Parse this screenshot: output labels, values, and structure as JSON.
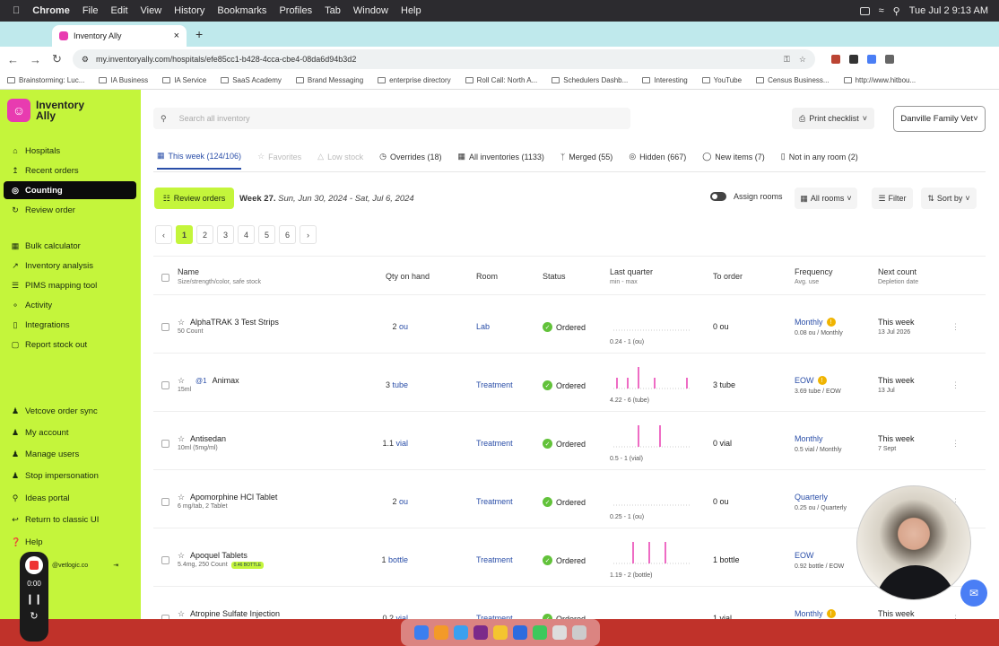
{
  "menubar": {
    "app": "Chrome",
    "items": [
      "File",
      "Edit",
      "View",
      "History",
      "Bookmarks",
      "Profiles",
      "Tab",
      "Window",
      "Help"
    ],
    "clock": "Tue Jul 2  9:13 AM"
  },
  "browser": {
    "tab_title": "Inventory Ally",
    "url": "my.inventoryally.com/hospitals/efe85cc1-b428-4cca-cbe4-08da6d94b3d2",
    "bookmarks": [
      "Brainstorming: Luc...",
      "IA Business",
      "IA Service",
      "SaaS Academy",
      "Brand Messaging",
      "enterprise directory",
      "Roll Call: North A...",
      "Schedulers Dashb...",
      "Interesting",
      "YouTube",
      "Census Business...",
      "http://www.hitbou..."
    ]
  },
  "sidebar": {
    "brand": "Inventory Ally",
    "items": [
      "Hospitals",
      "Recent orders",
      "Counting",
      "Review order",
      "Bulk calculator",
      "Inventory analysis",
      "PIMS mapping tool",
      "Activity",
      "Integrations",
      "Report stock out",
      "Vetcove order sync",
      "My account",
      "Manage users",
      "Stop impersonation",
      "Ideas portal",
      "Return to classic UI",
      "Help"
    ],
    "email_partial": "@vetlogic.co",
    "recorder_time": "0:00"
  },
  "header": {
    "search_placeholder": "Search all inventory",
    "print_checklist": "Print checklist",
    "clinic": "Danville Family Vet"
  },
  "tabs": [
    "This week (124/106)",
    "Favorites",
    "Low stock",
    "Overrides (18)",
    "All inventories (1133)",
    "Merged (55)",
    "Hidden (667)",
    "New items (7)",
    "Not in any room (2)"
  ],
  "toolbar": {
    "review_orders": "Review orders",
    "week_label": "Week 27.",
    "week_range": "Sun, Jun 30, 2024 - Sat, Jul 6, 2024",
    "assign_rooms": "Assign rooms",
    "all_rooms": "All rooms",
    "filter": "Filter",
    "sort_by": "Sort by"
  },
  "pager": [
    "1",
    "2",
    "3",
    "4",
    "5",
    "6"
  ],
  "columns": {
    "name": "Name",
    "name_sub": "Size/strength/color, safe stock",
    "qty": "Qty on hand",
    "room": "Room",
    "status": "Status",
    "last_quarter": "Last quarter",
    "last_quarter_sub": "min - max",
    "to_order": "To order",
    "frequency": "Frequency",
    "frequency_sub": "Avg. use",
    "next_count": "Next count",
    "next_count_sub": "Depletion date"
  },
  "rows": [
    {
      "name": "AlphaTRAK 3 Test Strips",
      "sub": "50 Count",
      "qty": "2",
      "unit": "ou",
      "room": "Lab",
      "status": "Ordered",
      "range": "0.24 - 1 (ou)",
      "order": "0 ou",
      "freq": "Monthly",
      "fsub": "0.08 ou / Monthly",
      "next": "This week",
      "nsub": "13 Jul 2026"
    },
    {
      "name": "Animax",
      "chip": "@1",
      "sub": "15ml",
      "qty": "3",
      "unit": "tube",
      "room": "Treatment",
      "status": "Ordered",
      "range": "4.22 - 6 (tube)",
      "order": "3 tube",
      "freq": "EOW",
      "fsub": "3.69 tube / EOW",
      "next": "This week",
      "nsub": "13 Jul"
    },
    {
      "name": "Antisedan",
      "sub": "10ml (5mg/ml)",
      "qty": "1.1",
      "unit": "vial",
      "room": "Treatment",
      "status": "Ordered",
      "range": "0.5 - 1 (vial)",
      "order": "0 vial",
      "freq": "Monthly",
      "fsub": "0.5 vial / Monthly",
      "next": "This week",
      "nsub": "7 Sept"
    },
    {
      "name": "Apomorphine HCl Tablet",
      "sub": "6 mg/tab, 2 Tablet",
      "qty": "2",
      "unit": "ou",
      "room": "Treatment",
      "status": "Ordered",
      "range": "0.25 - 1 (ou)",
      "order": "0 ou",
      "freq": "Quarterly",
      "fsub": "0.25 ou / Quarterly",
      "next": "",
      "nsub": ""
    },
    {
      "name": "Apoquel Tablets",
      "sub": "5.4mg, 250 Count",
      "badge": "0.46 BOTTLE",
      "qty": "1",
      "unit": "bottle",
      "room": "Treatment",
      "status": "Ordered",
      "range": "1.19 - 2 (bottle)",
      "order": "1 bottle",
      "freq": "EOW",
      "fsub": "0.92 bottle / EOW",
      "next": "",
      "nsub": ""
    },
    {
      "name": "Atropine Sulfate Injection",
      "sub": "",
      "qty": "0.2",
      "unit": "vial",
      "room": "Treatment",
      "status": "Ordered",
      "range": "",
      "order": "1 vial",
      "freq": "Monthly",
      "fsub": "",
      "next": "This week",
      "nsub": ""
    }
  ],
  "colors": {
    "accent": "#c4f53b",
    "link": "#2a4ea8",
    "brand_pink": "#e83bb0",
    "spark": "#e83bb0"
  }
}
